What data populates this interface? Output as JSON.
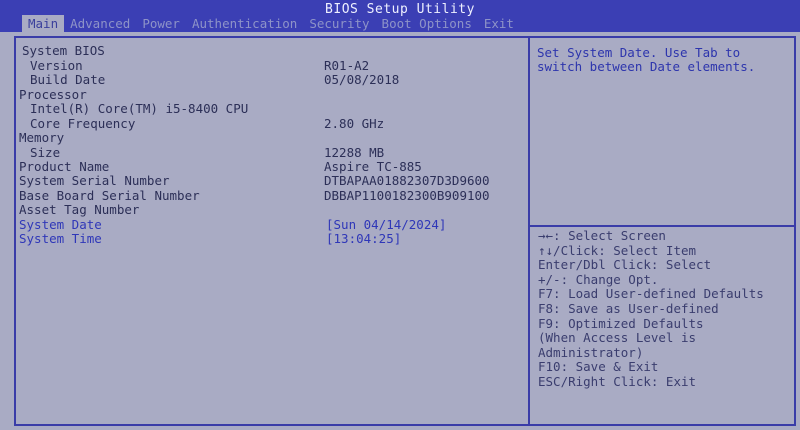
{
  "title": "BIOS Setup Utility",
  "tabs": [
    "Main",
    "Advanced",
    "Power",
    "Authentication",
    "Security",
    "Boot Options",
    "Exit"
  ],
  "main": {
    "system_bios": "System BIOS",
    "version_label": "Version",
    "version_value": "R01-A2",
    "build_date_label": "Build Date",
    "build_date_value": "05/08/2018",
    "processor": "Processor",
    "cpu_name": "Intel(R) Core(TM) i5-8400 CPU",
    "core_freq_label": "Core Frequency",
    "core_freq_value": "2.80 GHz",
    "memory": "Memory",
    "size_label": "Size",
    "size_value": "12288 MB",
    "product_name_label": "Product Name",
    "product_name_value": "Aspire TC-885",
    "system_serial_label": "System Serial Number",
    "system_serial_value": "DTBAPAA01882307D3D9600",
    "board_serial_label": "Base Board Serial Number",
    "board_serial_value": "DBBAP1100182300B909100",
    "asset_tag_label": "Asset Tag Number",
    "system_date_label": "System Date",
    "system_date_value": "[Sun 04/14/2024]",
    "system_time_label": "System Time",
    "system_time_value": "[13:04:25]"
  },
  "help_text": "Set System Date. Use Tab to switch between Date elements.",
  "keys": [
    "→←: Select Screen",
    "↑↓/Click: Select Item",
    "Enter/Dbl Click: Select",
    "+/-: Change Opt.",
    "F7: Load User-defined Defaults",
    "F8: Save as User-defined",
    "F9: Optimized Defaults",
    "(When Access Level is",
    "Administrator)",
    "F10: Save & Exit",
    "ESC/Right Click: Exit"
  ],
  "colors": {
    "background": "#a9abc4",
    "header": "#3b3fb4",
    "highlight": "#2f37b8"
  }
}
